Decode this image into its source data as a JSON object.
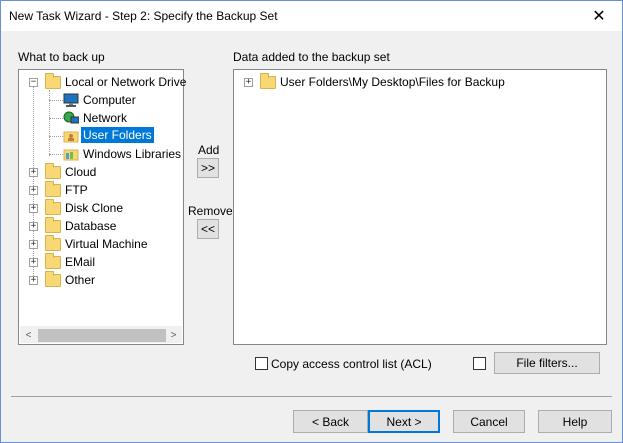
{
  "window": {
    "title": "New Task Wizard - Step 2: Specify the Backup Set",
    "close_glyph": "✕"
  },
  "left_panel": {
    "label": "What to back up",
    "tree": {
      "root": {
        "label": "Local or Network Drive",
        "expander": "−"
      },
      "children": [
        {
          "label": "Computer",
          "icon": "computer-icon"
        },
        {
          "label": "Network",
          "icon": "network-icon"
        },
        {
          "label": "User Folders",
          "icon": "folder-icon",
          "selected": true
        },
        {
          "label": "Windows Libraries",
          "icon": "libraries-icon"
        }
      ],
      "top_level": [
        {
          "label": "Cloud",
          "expander": "+"
        },
        {
          "label": "FTP",
          "expander": "+"
        },
        {
          "label": "Disk Clone",
          "expander": "+"
        },
        {
          "label": "Database",
          "expander": "+"
        },
        {
          "label": "Virtual Machine",
          "expander": "+"
        },
        {
          "label": "EMail",
          "expander": "+"
        },
        {
          "label": "Other",
          "expander": "+"
        }
      ]
    },
    "scroll_left": "<",
    "scroll_right": ">"
  },
  "middle": {
    "add_label": "Add",
    "add_button": ">>",
    "remove_label": "Remove",
    "remove_button": "<<"
  },
  "right_panel": {
    "label": "Data added to the backup set",
    "items": [
      {
        "label": "User Folders\\My Desktop\\Files for Backup",
        "expander": "+"
      }
    ]
  },
  "options": {
    "acl_label": "Copy access control list (ACL)",
    "acl_checked": false,
    "file_filters_checked": false,
    "file_filters_button": "File filters..."
  },
  "footer": {
    "back": "< Back",
    "next": "Next >",
    "cancel": "Cancel",
    "help": "Help"
  }
}
